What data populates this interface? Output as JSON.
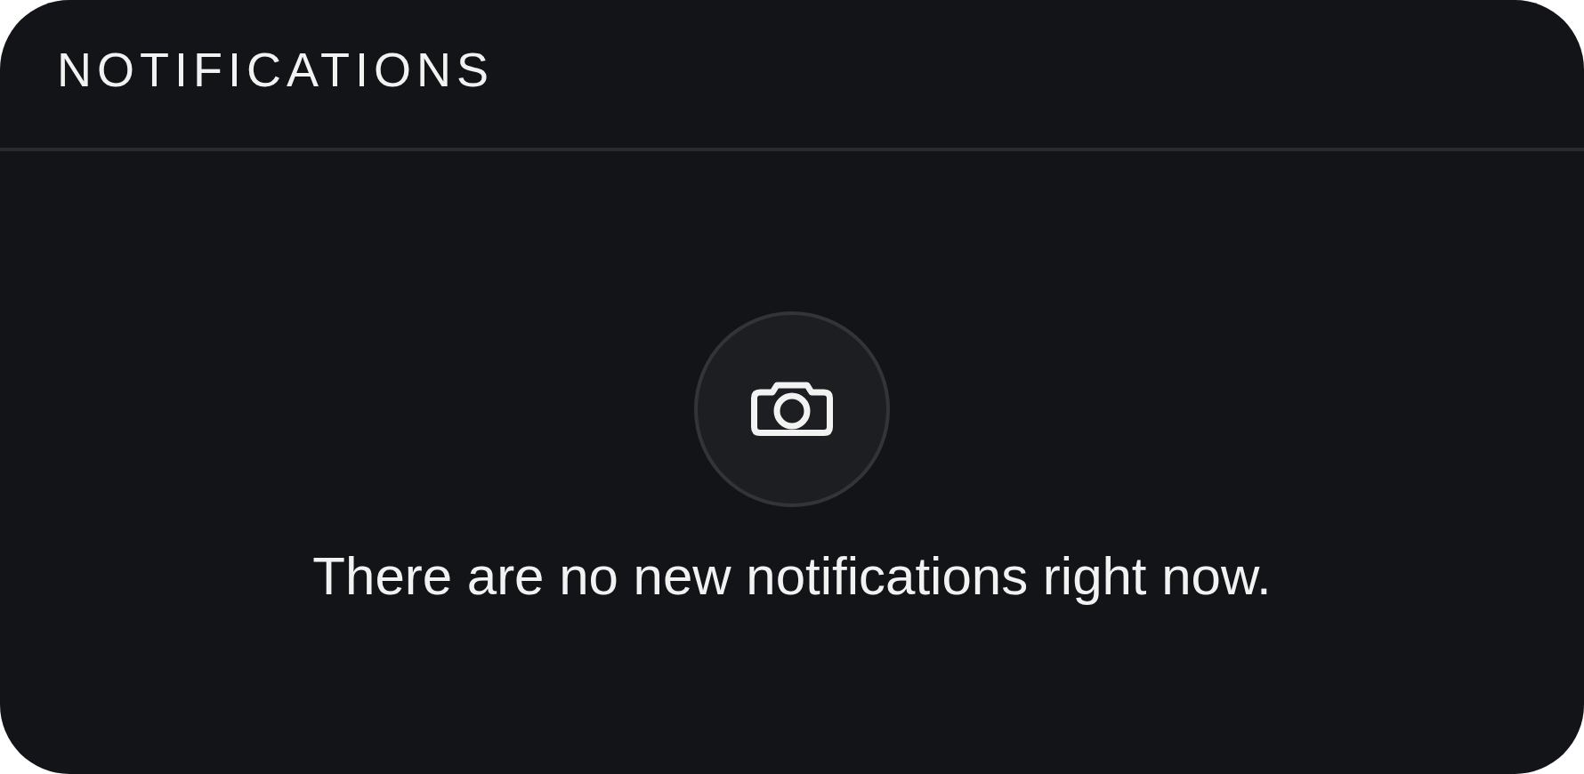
{
  "header": {
    "title": "NOTIFICATIONS"
  },
  "empty_state": {
    "message": "There are no new notifications right now."
  }
}
